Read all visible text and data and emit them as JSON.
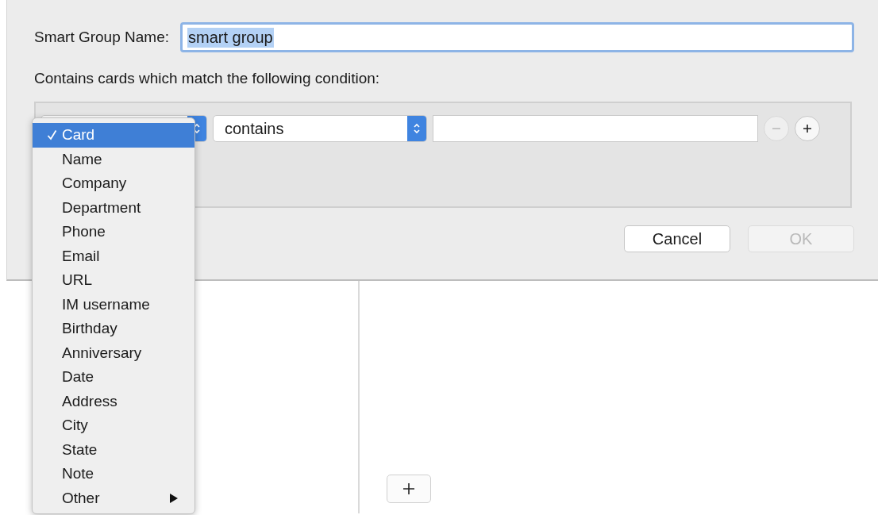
{
  "dialog": {
    "name_label": "Smart Group Name:",
    "name_value": "smart group",
    "name_selected": true,
    "condition_label": "Contains cards which match the following condition:",
    "condition": {
      "operator": "contains"
    },
    "buttons": [
      {
        "label": "Cancel",
        "disabled": false
      },
      {
        "label": "OK",
        "disabled": true
      }
    ]
  },
  "field_menu": {
    "items": [
      {
        "label": "Card",
        "checked": true,
        "selected": true,
        "submenu": false
      },
      {
        "label": "Name",
        "checked": false,
        "selected": false,
        "submenu": false
      },
      {
        "label": "Company",
        "checked": false,
        "selected": false,
        "submenu": false
      },
      {
        "label": "Department",
        "checked": false,
        "selected": false,
        "submenu": false
      },
      {
        "label": "Phone",
        "checked": false,
        "selected": false,
        "submenu": false
      },
      {
        "label": "Email",
        "checked": false,
        "selected": false,
        "submenu": false
      },
      {
        "label": "URL",
        "checked": false,
        "selected": false,
        "submenu": false
      },
      {
        "label": "IM username",
        "checked": false,
        "selected": false,
        "submenu": false
      },
      {
        "label": "Birthday",
        "checked": false,
        "selected": false,
        "submenu": false
      },
      {
        "label": "Anniversary",
        "checked": false,
        "selected": false,
        "submenu": false
      },
      {
        "label": "Date",
        "checked": false,
        "selected": false,
        "submenu": false
      },
      {
        "label": "Address",
        "checked": false,
        "selected": false,
        "submenu": false
      },
      {
        "label": "City",
        "checked": false,
        "selected": false,
        "submenu": false
      },
      {
        "label": "State",
        "checked": false,
        "selected": false,
        "submenu": false
      },
      {
        "label": "Note",
        "checked": false,
        "selected": false,
        "submenu": false
      },
      {
        "label": "Other",
        "checked": false,
        "selected": false,
        "submenu": true
      }
    ]
  }
}
